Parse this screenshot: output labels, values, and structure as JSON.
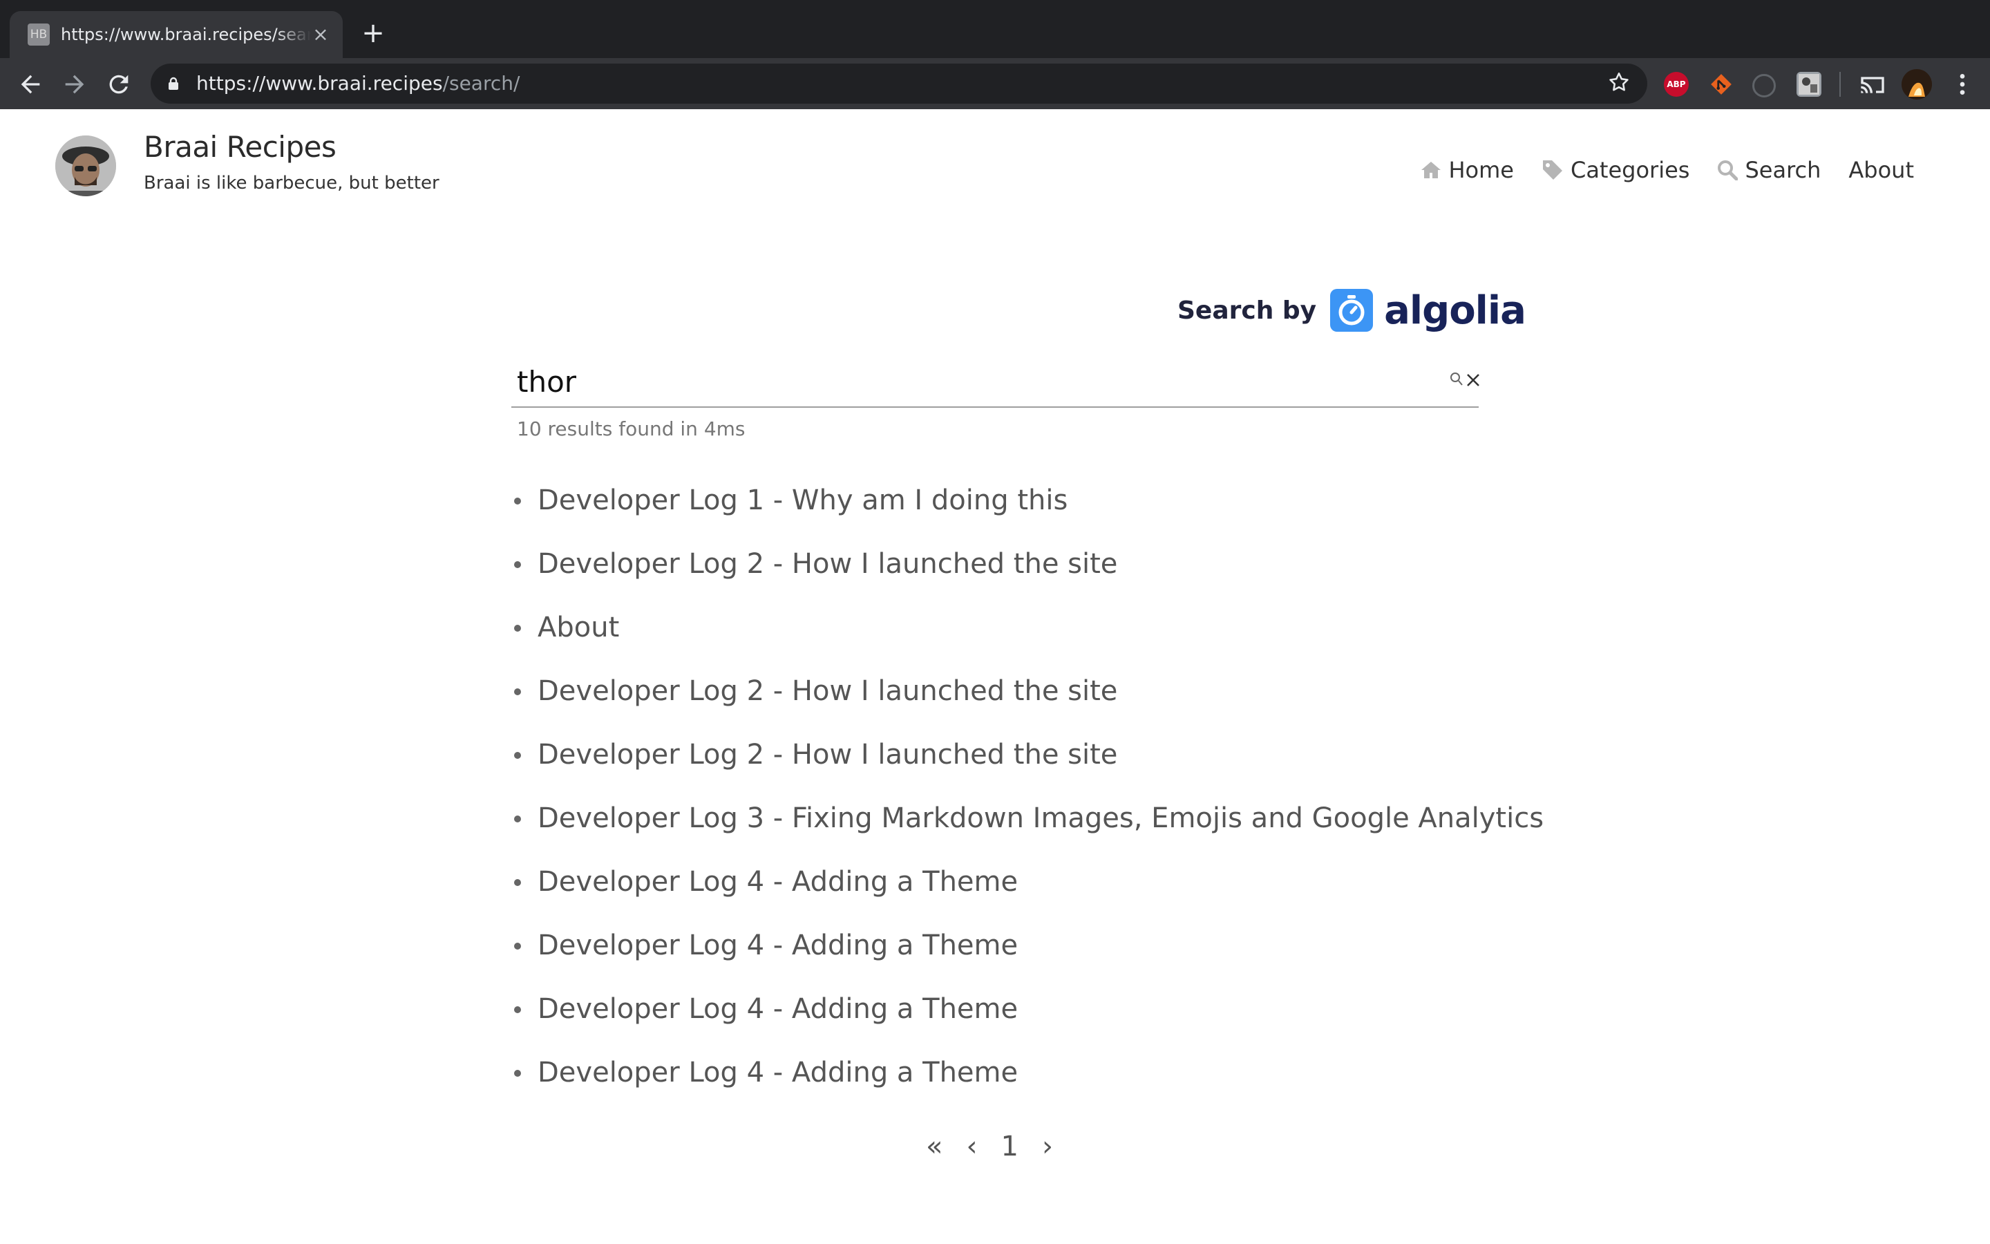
{
  "browser": {
    "tab": {
      "favicon_text": "HB",
      "title": "https://www.braai.recipes/search/",
      "close": "×"
    },
    "new_tab": "+",
    "url": {
      "host": "https://www.braai.recipes",
      "path": "/search/"
    },
    "extensions": {
      "abp": "ABP"
    }
  },
  "site": {
    "title": "Braai Recipes",
    "tagline": "Braai is like barbecue, but better"
  },
  "nav": {
    "home": "Home",
    "categories": "Categories",
    "search": "Search",
    "about": "About"
  },
  "algolia": {
    "label": "Search by",
    "brand": "algolia"
  },
  "search": {
    "query": "thor",
    "stats": "10 results found in 4ms"
  },
  "results": [
    "Developer Log 1 - Why am I doing this",
    "Developer Log 2 - How I launched the site",
    "About",
    "Developer Log 2 - How I launched the site",
    "Developer Log 2 - How I launched the site",
    "Developer Log 3 - Fixing Markdown Images, Emojis and Google Analytics",
    "Developer Log 4 - Adding a Theme",
    "Developer Log 4 - Adding a Theme",
    "Developer Log 4 - Adding a Theme",
    "Developer Log 4 - Adding a Theme"
  ],
  "pagination": {
    "first": "«",
    "prev": "‹",
    "current": "1",
    "next": "›"
  }
}
